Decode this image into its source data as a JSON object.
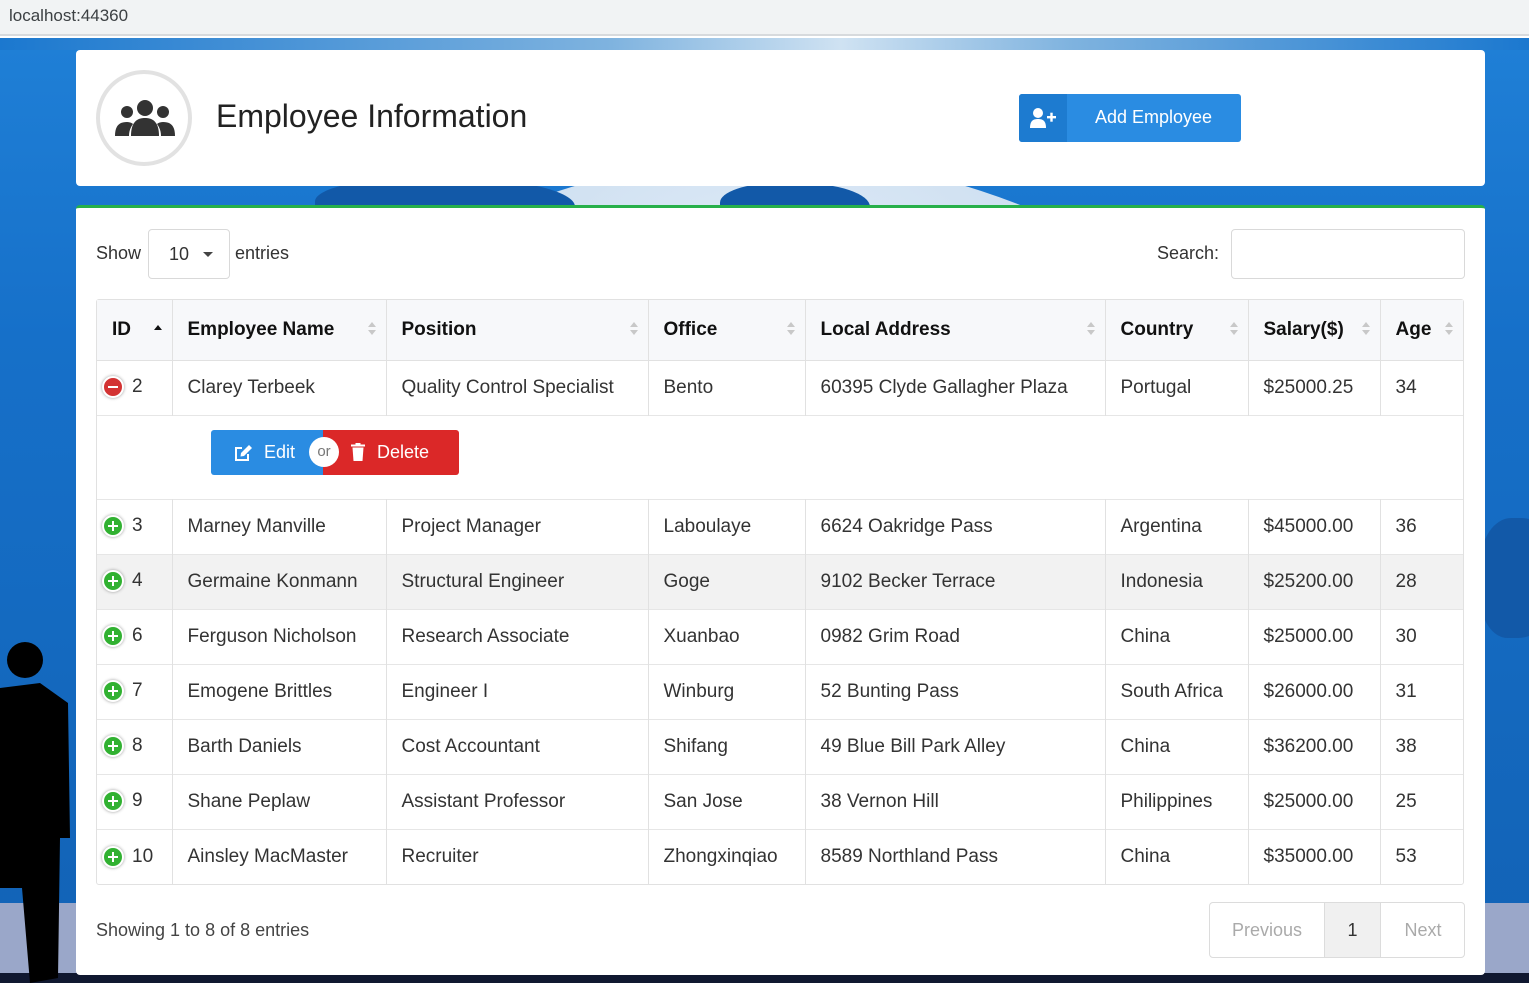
{
  "browser": {
    "address": "localhost:44360"
  },
  "header": {
    "title": "Employee Information",
    "add_button_label": "Add Employee"
  },
  "controls": {
    "show_label": "Show",
    "entries_value": "10",
    "entries_label": "entries",
    "search_label": "Search:",
    "search_value": ""
  },
  "table": {
    "columns": [
      "ID",
      "Employee Name",
      "Position",
      "Office",
      "Local Address",
      "Country",
      "Salary($)",
      "Age"
    ],
    "sorted_column": "ID",
    "sort_direction": "ascending",
    "rows": [
      {
        "id": "2",
        "name": "Clarey Terbeek",
        "position": "Quality Control Specialist",
        "office": "Bento",
        "address": "60395 Clyde Gallagher Plaza",
        "country": "Portugal",
        "salary": "$25000.25",
        "age": "34",
        "expanded": true
      },
      {
        "id": "3",
        "name": "Marney Manville",
        "position": "Project Manager",
        "office": "Laboulaye",
        "address": "6624 Oakridge Pass",
        "country": "Argentina",
        "salary": "$45000.00",
        "age": "36",
        "expanded": false
      },
      {
        "id": "4",
        "name": "Germaine Konmann",
        "position": "Structural Engineer",
        "office": "Goge",
        "address": "9102 Becker Terrace",
        "country": "Indonesia",
        "salary": "$25200.00",
        "age": "28",
        "expanded": false
      },
      {
        "id": "6",
        "name": "Ferguson Nicholson",
        "position": "Research Associate",
        "office": "Xuanbao",
        "address": "0982 Grim Road",
        "country": "China",
        "salary": "$25000.00",
        "age": "30",
        "expanded": false
      },
      {
        "id": "7",
        "name": "Emogene Brittles",
        "position": "Engineer I",
        "office": "Winburg",
        "address": "52 Bunting Pass",
        "country": "South Africa",
        "salary": "$26000.00",
        "age": "31",
        "expanded": false
      },
      {
        "id": "8",
        "name": "Barth Daniels",
        "position": "Cost Accountant",
        "office": "Shifang",
        "address": "49 Blue Bill Park Alley",
        "country": "China",
        "salary": "$36200.00",
        "age": "38",
        "expanded": false
      },
      {
        "id": "9",
        "name": "Shane Peplaw",
        "position": "Assistant Professor",
        "office": "San Jose",
        "address": "38 Vernon Hill",
        "country": "Philippines",
        "salary": "$25000.00",
        "age": "25",
        "expanded": false
      },
      {
        "id": "10",
        "name": "Ainsley MacMaster",
        "position": "Recruiter",
        "office": "Zhongxinqiao",
        "address": "8589 Northland Pass",
        "country": "China",
        "salary": "$35000.00",
        "age": "53",
        "expanded": false
      }
    ],
    "child_actions": {
      "edit_label": "Edit",
      "or_label": "or",
      "delete_label": "Delete"
    }
  },
  "footer": {
    "info": "Showing 1 to 8 of 8 entries",
    "previous_label": "Previous",
    "current_page": "1",
    "next_label": "Next"
  },
  "colors": {
    "primary_button": "#2a8ce2",
    "delete_button": "#db2828",
    "expand_icon": "#31b131",
    "collapse_icon": "#d33333",
    "card_accent": "#27b04a",
    "page_background": "#1670c9"
  },
  "icons": {
    "header_avatar": "users-group-icon",
    "add_button": "user-plus-icon",
    "edit_button": "edit-icon",
    "delete_button": "trash-icon"
  }
}
